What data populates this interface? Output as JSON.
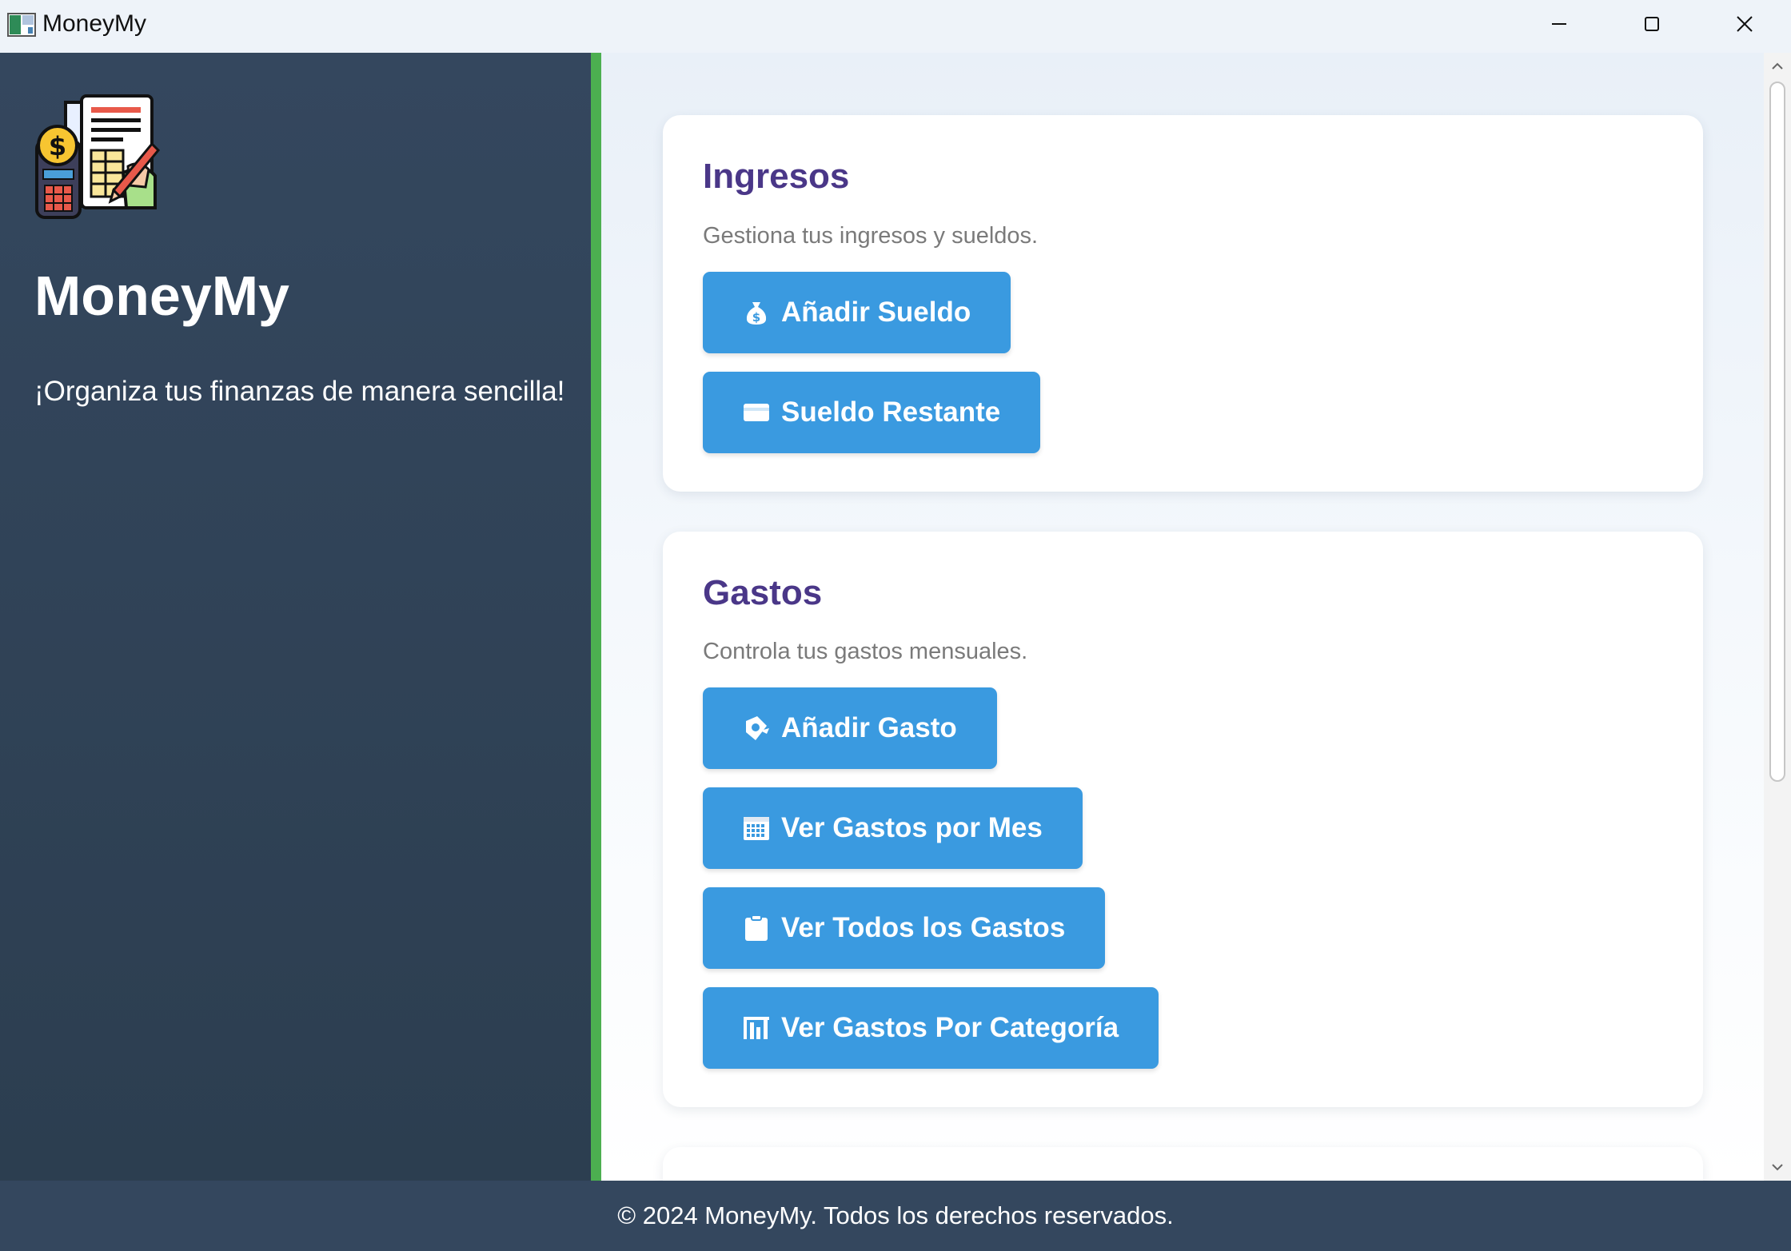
{
  "window": {
    "title": "MoneyMy",
    "minimize_icon": "minimize-icon",
    "maximize_icon": "maximize-icon",
    "close_icon": "close-icon"
  },
  "sidebar": {
    "logo_icon": "finance-calculator-document-icon",
    "title": "MoneyMy",
    "tagline": "¡Organiza tus finanzas de manera sencilla!",
    "background": "#2c3e50",
    "accent_border": "#4caf50"
  },
  "main": {
    "sections": [
      {
        "title": "Ingresos",
        "description": "Gestiona tus ingresos y sueldos.",
        "buttons": [
          {
            "label": "Añadir Sueldo",
            "icon": "money-bag-icon"
          },
          {
            "label": "Sueldo Restante",
            "icon": "credit-card-icon"
          }
        ]
      },
      {
        "title": "Gastos",
        "description": "Controla tus gastos mensuales.",
        "buttons": [
          {
            "label": "Añadir Gasto",
            "icon": "money-wings-icon"
          },
          {
            "label": "Ver Gastos por Mes",
            "icon": "calendar-icon"
          },
          {
            "label": "Ver Todos los Gastos",
            "icon": "clipboard-icon"
          },
          {
            "label": "Ver Gastos Por Categoría",
            "icon": "bar-chart-icon"
          }
        ]
      }
    ]
  },
  "colors": {
    "section_title": "#4a3788",
    "button": "#3a9ae0",
    "footer": "#34475e"
  },
  "footer": {
    "text": "© 2024 MoneyMy. Todos los derechos reservados."
  }
}
